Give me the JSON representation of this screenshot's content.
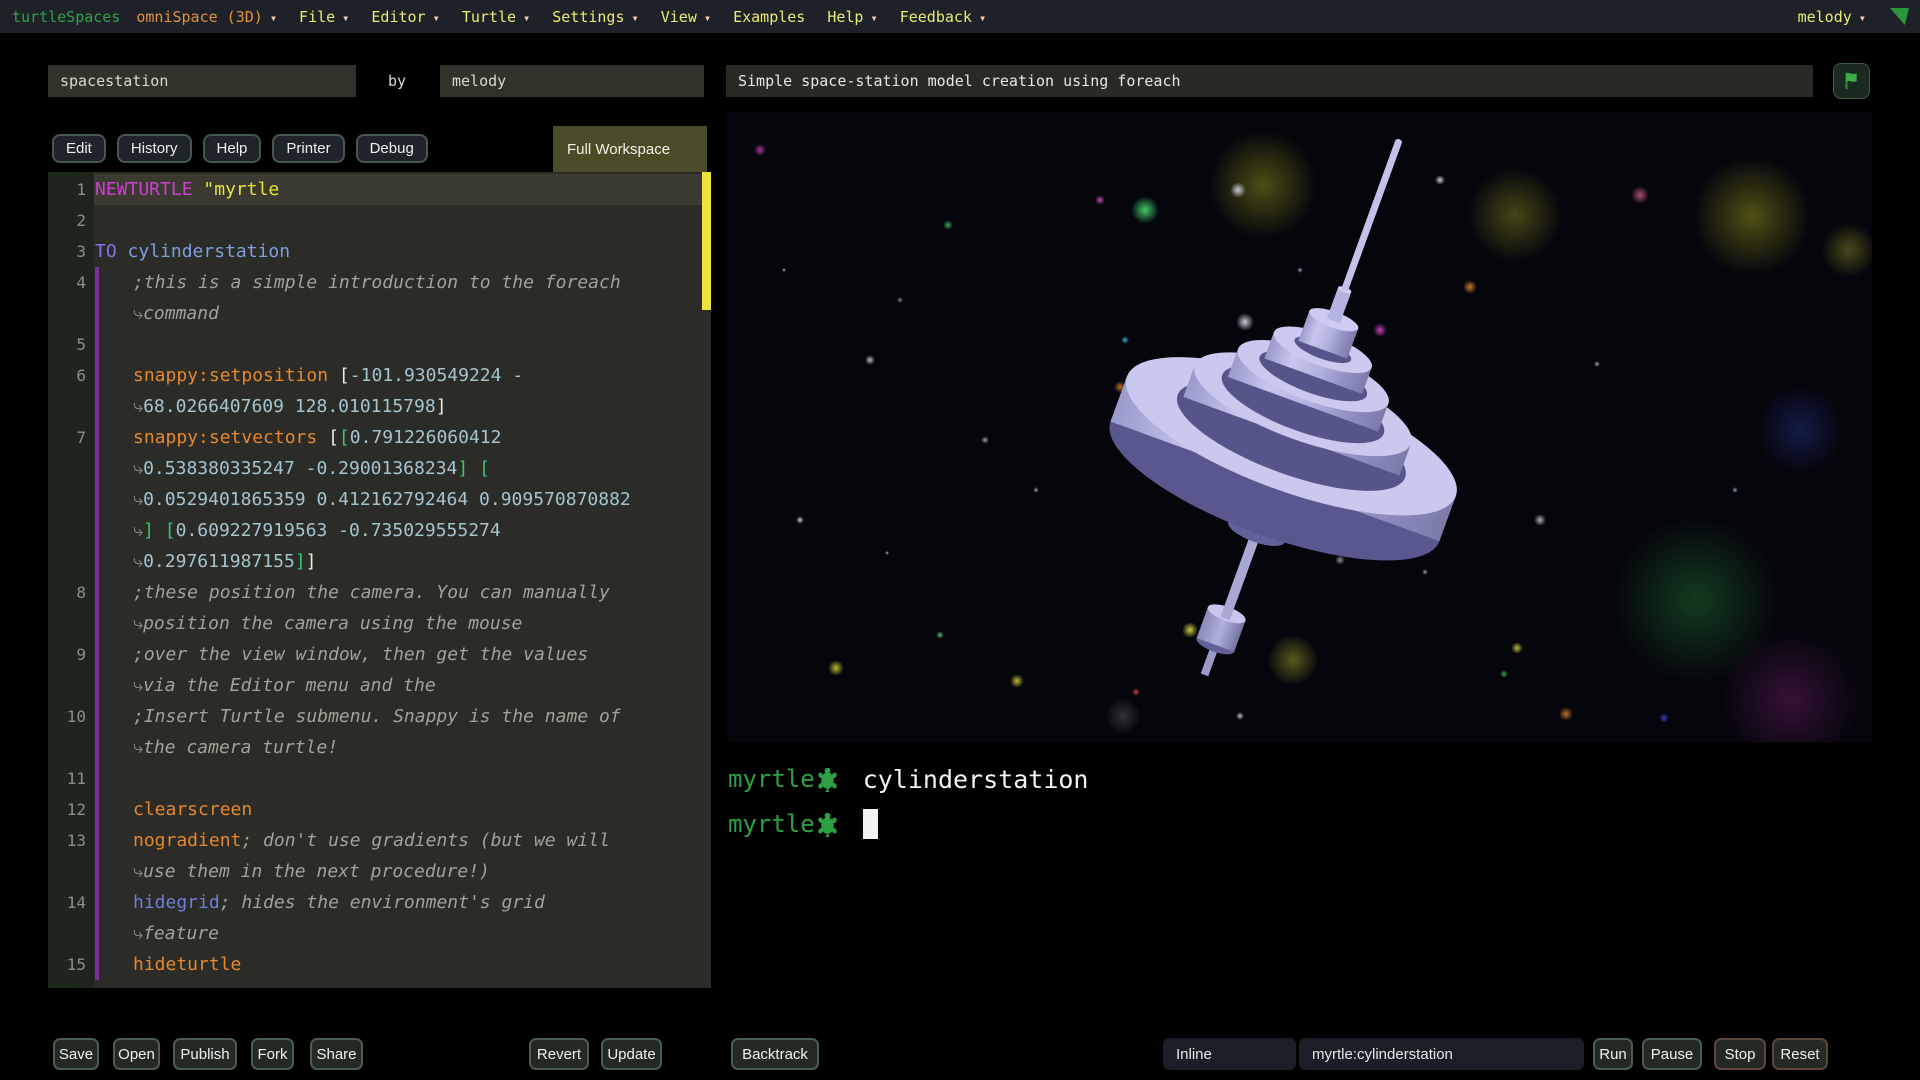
{
  "colors": {
    "menubar_bg": "#1e2127",
    "brand_green": "#2fa148",
    "workspace_orange": "#e0913c",
    "menu_yellow": "#e9ec72",
    "caret_peach": "#f2cdb2",
    "corner_triangle_green": "#2b9639",
    "editor_bg": "#2b2b27",
    "gutter_bg": "#1d251d",
    "line_highlight": "#3a3a30",
    "indent_guide_purple": "#7c2f9c",
    "scrollbar_yellow": "#ece23e",
    "tab_border_green": "#45584e",
    "fullws_olive": "#4b4b27",
    "prompt_green": "#2da044",
    "station_top": "#c9c9ef",
    "station_side": "#b0b0dd",
    "station_under": "#58588e",
    "warn_border": "#5c463c"
  },
  "menubar": {
    "brand": "turtleSpaces",
    "workspace": "omniSpace (3D)",
    "file": "File",
    "editor": "Editor",
    "turtle": "Turtle",
    "settings": "Settings",
    "view": "View",
    "examples": "Examples",
    "help": "Help",
    "feedback": "Feedback",
    "user": "melody"
  },
  "header": {
    "title_value": "spacestation",
    "by_label": "by",
    "author_value": "melody",
    "description_value": "Simple space-station model creation using foreach"
  },
  "tabs": {
    "edit": "Edit",
    "history": "History",
    "help": "Help",
    "printer": "Printer",
    "debug": "Debug",
    "full_workspace": "Full Workspace"
  },
  "editor": {
    "rows": [
      {
        "n": "1",
        "hl": true,
        "t": [
          [
            "k1",
            "NEWTURTLE"
          ],
          [
            "pl",
            " "
          ],
          [
            "st",
            "\"myrtle"
          ]
        ]
      },
      {
        "n": "2",
        "t": []
      },
      {
        "n": "3",
        "t": [
          [
            "k2",
            "TO"
          ],
          [
            "pl",
            " "
          ],
          [
            "nm",
            "cylinderstation"
          ]
        ]
      },
      {
        "n": "4",
        "i": 1,
        "t": [
          [
            "cm",
            ";this is a simple introduction to the foreach"
          ]
        ]
      },
      {
        "w": 1,
        "t": [
          [
            "cm",
            "command"
          ]
        ]
      },
      {
        "n": "5",
        "t": []
      },
      {
        "n": "6",
        "i": 1,
        "t": [
          [
            "op",
            "snappy:setposition"
          ],
          [
            "pl",
            " "
          ],
          [
            "b1",
            "["
          ],
          [
            "nu",
            "-101.930549224 -"
          ]
        ]
      },
      {
        "w": 1,
        "t": [
          [
            "nu",
            "68.0266407609 128.010115798"
          ],
          [
            "b1",
            "]"
          ]
        ]
      },
      {
        "n": "7",
        "i": 1,
        "t": [
          [
            "op",
            "snappy:setvectors"
          ],
          [
            "pl",
            " "
          ],
          [
            "b1",
            "["
          ],
          [
            "b2",
            "["
          ],
          [
            "nu",
            "0.791226060412"
          ]
        ]
      },
      {
        "w": 1,
        "t": [
          [
            "nu",
            "0.538380335247 -0.29001368234"
          ],
          [
            "b2",
            "]"
          ],
          [
            "pl",
            " "
          ],
          [
            "b2",
            "["
          ]
        ]
      },
      {
        "w": 1,
        "t": [
          [
            "nu",
            "0.0529401865359 0.412162792464 0.909570870882"
          ]
        ]
      },
      {
        "w": 1,
        "t": [
          [
            "b2",
            "]"
          ],
          [
            "pl",
            " "
          ],
          [
            "b2",
            "["
          ],
          [
            "nu",
            "0.609227919563 -0.735029555274"
          ]
        ]
      },
      {
        "w": 1,
        "t": [
          [
            "nu",
            "0.297611987155"
          ],
          [
            "b2",
            "]"
          ],
          [
            "b1",
            "]"
          ]
        ]
      },
      {
        "n": "8",
        "i": 1,
        "t": [
          [
            "cm",
            ";these position the camera. You can manually"
          ]
        ]
      },
      {
        "w": 1,
        "t": [
          [
            "cm",
            "position the camera using the mouse"
          ]
        ]
      },
      {
        "n": "9",
        "i": 1,
        "t": [
          [
            "cm",
            ";over the view window, then get the values"
          ]
        ]
      },
      {
        "w": 1,
        "t": [
          [
            "cm",
            "via the Editor menu and the"
          ]
        ]
      },
      {
        "n": "10",
        "i": 1,
        "t": [
          [
            "cm",
            ";Insert Turtle submenu. Snappy is the name of"
          ]
        ]
      },
      {
        "w": 1,
        "t": [
          [
            "cm",
            "the camera turtle!"
          ]
        ]
      },
      {
        "n": "11",
        "t": []
      },
      {
        "n": "12",
        "i": 1,
        "t": [
          [
            "op",
            "clearscreen"
          ]
        ]
      },
      {
        "n": "13",
        "i": 1,
        "t": [
          [
            "op",
            "nogradient"
          ],
          [
            "cm",
            "; don't use gradients (but we will"
          ]
        ]
      },
      {
        "w": 1,
        "t": [
          [
            "cm",
            "use them in the next procedure!)"
          ]
        ]
      },
      {
        "n": "14",
        "i": 1,
        "t": [
          [
            "bl",
            "hidegrid"
          ],
          [
            "cm",
            "; hides the environment's grid"
          ]
        ]
      },
      {
        "w": 1,
        "t": [
          [
            "cm",
            "feature"
          ]
        ]
      },
      {
        "n": "15",
        "i": 1,
        "t": [
          [
            "op",
            "hideturtle"
          ]
        ]
      }
    ]
  },
  "viewport": {
    "stars": [
      [
        36.5,
        15.6,
        14,
        "rgba(70,210,110,0.95)"
      ],
      [
        46.8,
        11.6,
        55,
        "rgba(150,150,30,0.5)"
      ],
      [
        68.8,
        16.3,
        48,
        "rgba(150,150,35,0.45)"
      ],
      [
        89.5,
        16.5,
        60,
        "rgba(155,155,30,0.5)"
      ],
      [
        44.6,
        12.4,
        8,
        "rgba(220,220,235,0.9)"
      ],
      [
        45.2,
        33.3,
        9,
        "rgba(225,225,240,0.9)"
      ],
      [
        57.0,
        34.6,
        7,
        "rgba(215,70,200,0.9)"
      ],
      [
        34.8,
        36.2,
        4,
        "rgba(70,190,220,0.9)"
      ],
      [
        64.9,
        27.8,
        7,
        "rgba(215,135,45,0.9)"
      ],
      [
        32.6,
        14.0,
        5,
        "rgba(215,80,165,0.9)"
      ],
      [
        34.3,
        43.7,
        6,
        "rgba(210,125,35,0.9)"
      ],
      [
        2.9,
        6.0,
        6,
        "rgba(195,70,180,0.85)"
      ],
      [
        19.3,
        17.9,
        5,
        "rgba(60,180,100,0.9)"
      ],
      [
        12.5,
        39.4,
        5,
        "rgba(205,205,220,0.9)"
      ],
      [
        6.4,
        64.8,
        4,
        "rgba(210,210,225,0.9)"
      ],
      [
        9.5,
        88.3,
        8,
        "rgba(205,205,55,0.9)"
      ],
      [
        25.3,
        90.3,
        7,
        "rgba(205,205,60,0.9)"
      ],
      [
        40.4,
        82.2,
        8,
        "rgba(215,215,70,0.95)"
      ],
      [
        49.4,
        87.0,
        26,
        "rgba(160,160,45,0.55)"
      ],
      [
        35.7,
        92.1,
        4,
        "rgba(215,70,70,0.9)"
      ],
      [
        73.3,
        95.6,
        7,
        "rgba(215,125,45,0.9)"
      ],
      [
        81.8,
        96.2,
        5,
        "rgba(60,70,200,0.9)"
      ],
      [
        69.0,
        85.1,
        6,
        "rgba(205,205,70,0.9)"
      ],
      [
        67.9,
        89.2,
        4,
        "rgba(60,185,90,0.9)"
      ],
      [
        84.6,
        77.5,
        85,
        "rgba(30,110,45,0.5)"
      ],
      [
        92.8,
        93.3,
        70,
        "rgba(100,30,95,0.5)"
      ],
      [
        93.7,
        50.5,
        45,
        "rgba(35,55,140,0.45)"
      ],
      [
        98.0,
        21.9,
        28,
        "rgba(140,140,40,0.5)"
      ],
      [
        62.3,
        10.8,
        5,
        "rgba(225,225,238,0.9)"
      ],
      [
        79.7,
        13.2,
        9,
        "rgba(200,95,130,0.85)"
      ],
      [
        71.0,
        64.8,
        6,
        "rgba(205,205,215,0.85)"
      ],
      [
        44.8,
        95.9,
        4,
        "rgba(215,215,225,0.9)"
      ],
      [
        15.1,
        29.8,
        3,
        "rgba(170,170,180,0.8)"
      ],
      [
        22.5,
        52.1,
        4,
        "rgba(190,190,205,0.8)"
      ],
      [
        34.6,
        95.8,
        18,
        "rgba(150,150,160,0.3)"
      ],
      [
        53.5,
        71.1,
        5,
        "rgba(185,185,195,0.75)"
      ],
      [
        5.0,
        25.0,
        2,
        "rgba(255,255,255,0.8)"
      ],
      [
        14.0,
        70.0,
        2,
        "rgba(255,255,255,0.7)"
      ],
      [
        58.0,
        55.0,
        3,
        "rgba(230,230,240,0.8)"
      ],
      [
        76.0,
        40.0,
        3,
        "rgba(230,230,240,0.7)"
      ],
      [
        88.0,
        60.0,
        3,
        "rgba(200,220,255,0.7)"
      ],
      [
        50.0,
        25.0,
        3,
        "rgba(240,200,255,0.7)"
      ],
      [
        27.0,
        60.0,
        3,
        "rgba(255,255,255,0.6)"
      ],
      [
        61.0,
        73.0,
        3,
        "rgba(255,255,255,0.6)"
      ],
      [
        18.6,
        83.0,
        4,
        "rgba(120,220,140,0.8)"
      ]
    ]
  },
  "console": {
    "line1": {
      "prompt": "myrtle",
      "text": "cylinderstation"
    },
    "line2": {
      "prompt": "myrtle"
    }
  },
  "footer": {
    "save": "Save",
    "open": "Open",
    "publish": "Publish",
    "fork": "Fork",
    "share": "Share",
    "revert": "Revert",
    "update": "Update",
    "backtrack": "Backtrack",
    "inline_select": "Inline",
    "command_value": "myrtle:cylinderstation",
    "run": "Run",
    "pause": "Pause",
    "stop": "Stop",
    "reset": "Reset"
  }
}
